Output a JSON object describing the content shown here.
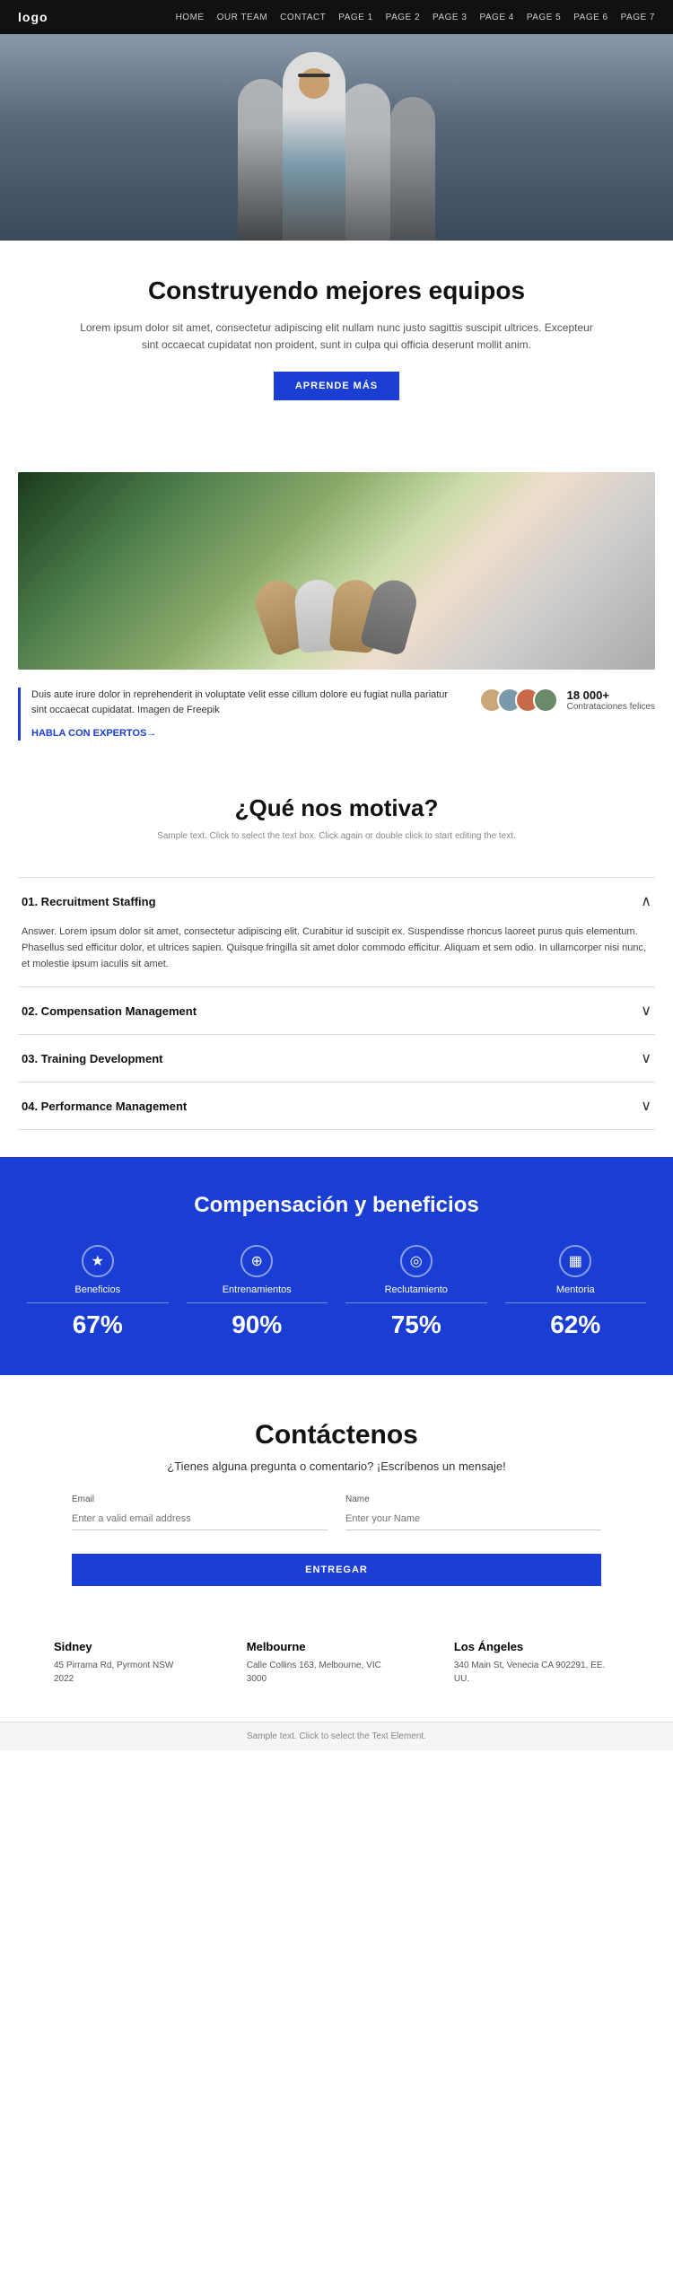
{
  "nav": {
    "logo": "logo",
    "links": [
      "HOME",
      "OUR TEAM",
      "CONTACT",
      "PAGE 1",
      "PAGE 2",
      "PAGE 3",
      "PAGE 4",
      "PAGE 5",
      "PAGE 6",
      "PAGE 7"
    ]
  },
  "intro": {
    "heading": "Construyendo mejores equipos",
    "body": "Lorem ipsum dolor sit amet, consectetur adipiscing elit nullam nunc justo sagittis suscipit ultrices. Excepteur sint occaecat cupidatat non proident, sunt in culpa qui officia deserunt mollit anim.",
    "button": "APRENDE MÁS"
  },
  "stats": {
    "text": "Duis aute irure dolor in reprehenderit in voluptate velit esse cillum dolore eu fugiat nulla pariatur sint occaecat cupidatat. Imagen de Freepik",
    "link": "HABLA CON EXPERTOS→",
    "count": "18 000+",
    "count_sub": "Contrataciones felices"
  },
  "motivation": {
    "heading": "¿Qué nos motiva?",
    "sample_text": "Sample text. Click to select the text box. Click again or double click to start editing the text.",
    "accordion": [
      {
        "id": 1,
        "title": "01. Recruitment Staffing",
        "open": true,
        "content": "Answer. Lorem ipsum dolor sit amet, consectetur adipiscing elit. Curabitur id suscipit ex. Suspendisse rhoncus laoreet purus quis elementum. Phasellus sed efficitur dolor, et ultrices sapien. Quisque fringilla sit amet dolor commodo efficitur. Aliquam et sem odio. In ullamcorper nisi nunc, et molestie ipsum iaculis sit amet."
      },
      {
        "id": 2,
        "title": "02. Compensation Management",
        "open": false,
        "content": ""
      },
      {
        "id": 3,
        "title": "03. Training Development",
        "open": false,
        "content": ""
      },
      {
        "id": 4,
        "title": "04. Performance Management",
        "open": false,
        "content": ""
      }
    ]
  },
  "benefits": {
    "heading": "Compensación y beneficios",
    "items": [
      {
        "icon": "★",
        "label": "Beneficios",
        "percent": "67%"
      },
      {
        "icon": "⊕",
        "label": "Entrenamientos",
        "percent": "90%"
      },
      {
        "icon": "◎",
        "label": "Reclutamiento",
        "percent": "75%"
      },
      {
        "icon": "▦",
        "label": "Mentoria",
        "percent": "62%"
      }
    ]
  },
  "contact": {
    "heading": "Contáctenos",
    "subtitle": "¿Tienes alguna pregunta o comentario? ¡Escríbenos un mensaje!",
    "email_label": "Email",
    "email_placeholder": "Enter a valid email address",
    "name_label": "Name",
    "name_placeholder": "Enter your Name",
    "button": "ENTREGAR",
    "offices": [
      {
        "city": "Sidney",
        "address": "45 Pirrama Rd, Pyrmont NSW 2022"
      },
      {
        "city": "Melbourne",
        "address": "Calle Collins 163, Melbourne, VIC 3000"
      },
      {
        "city": "Los Ángeles",
        "address": "340 Main St, Venecia CA 902291, EE. UU."
      }
    ]
  },
  "footer": {
    "note": "Sample text. Click to select the Text Element."
  }
}
